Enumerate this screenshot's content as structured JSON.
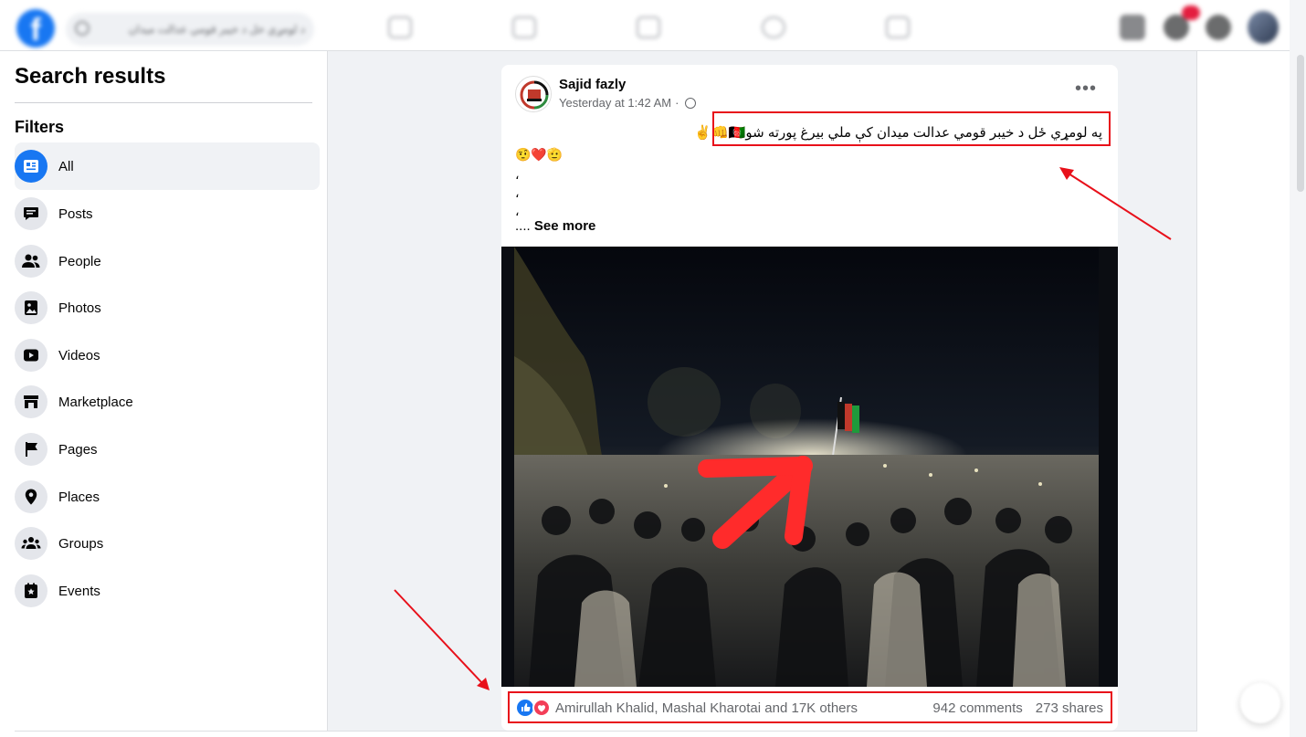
{
  "topbar": {
    "logo": "f",
    "search_text": "د لومړي خل د خیبر قومي عدالت میدان",
    "search_icon": "search-icon",
    "nav_icons": [
      "home-icon",
      "watch-icon",
      "marketplace-icon",
      "groups-icon",
      "gaming-icon"
    ],
    "right_icons": [
      "menu-icon",
      "messenger-icon",
      "notifications-icon"
    ],
    "notification_count": ""
  },
  "sidebar": {
    "title": "Search results",
    "filters_heading": "Filters",
    "items": [
      {
        "label": "All",
        "icon": "feed-icon",
        "active": true
      },
      {
        "label": "Posts",
        "icon": "posts-icon",
        "active": false
      },
      {
        "label": "People",
        "icon": "people-icon",
        "active": false
      },
      {
        "label": "Photos",
        "icon": "photos-icon",
        "active": false
      },
      {
        "label": "Videos",
        "icon": "videos-icon",
        "active": false
      },
      {
        "label": "Marketplace",
        "icon": "marketplace-icon",
        "active": false
      },
      {
        "label": "Pages",
        "icon": "flag-icon",
        "active": false
      },
      {
        "label": "Places",
        "icon": "location-icon",
        "active": false
      },
      {
        "label": "Groups",
        "icon": "groups-icon",
        "active": false
      },
      {
        "label": "Events",
        "icon": "calendar-icon",
        "active": false
      }
    ]
  },
  "post": {
    "author": "Sajid fazly",
    "timestamp": "Yesterday at 1:42 AM",
    "separator": "·",
    "privacy_icon": "globe-icon",
    "more": "•••",
    "text_line1": "په لومړي ځل د خیبر قومي عدالت میدان کې ملي بیرغ پورته شو🇦🇫👊✌️",
    "text_line2": "🤨❤️🫡",
    "text_dots": [
      "،",
      "،",
      "،"
    ],
    "see_more_prefix": ".... ",
    "see_more": "See more",
    "reactions_names": "Amirullah Khalid, Mashal Kharotai and 17K others",
    "comments": "942 comments",
    "shares": "273 shares"
  },
  "colors": {
    "brand": "#1877f2",
    "annotation": "#e8101a",
    "love": "#f33e58"
  }
}
